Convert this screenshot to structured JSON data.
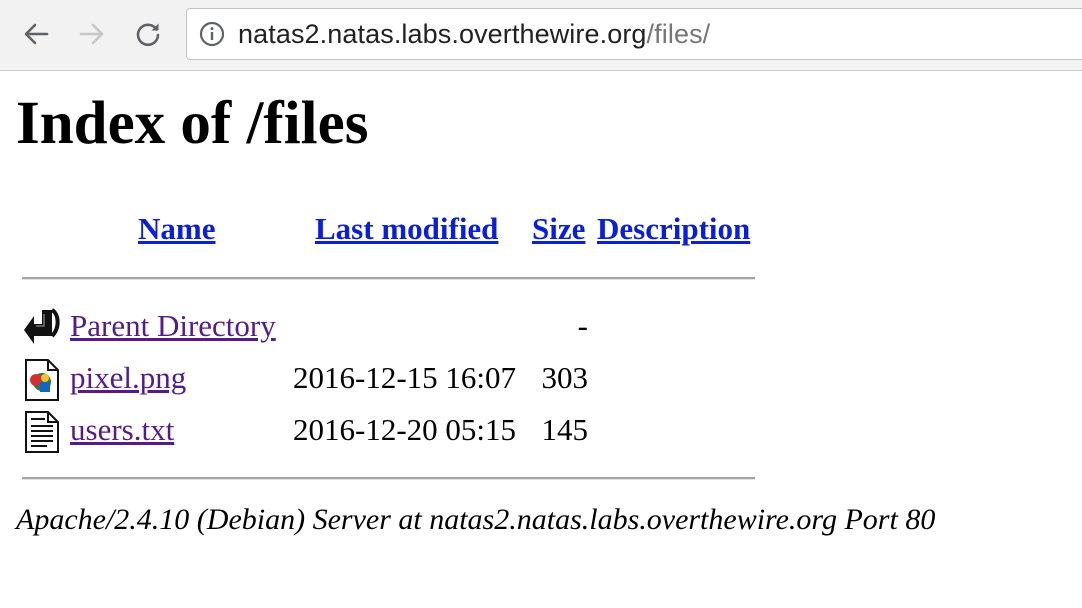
{
  "browser": {
    "url_host": "natas2.natas.labs.overthewire.org",
    "url_path": "/files/",
    "icons": {
      "back": "arrow-left-icon",
      "forward": "arrow-right-icon",
      "reload": "reload-icon",
      "site_info": "info-circle-icon"
    }
  },
  "page": {
    "title": "Index of /files",
    "columns": {
      "name": "Name",
      "modified": "Last modified",
      "size": "Size",
      "description": "Description"
    },
    "rows": [
      {
        "icon": "back-arrow-icon",
        "name": "Parent Directory",
        "modified": "",
        "size": "-",
        "description": ""
      },
      {
        "icon": "image-file-icon",
        "name": "pixel.png",
        "modified": "2016-12-15 16:07",
        "size": "303",
        "description": ""
      },
      {
        "icon": "text-file-icon",
        "name": "users.txt",
        "modified": "2016-12-20 05:15",
        "size": "145",
        "description": ""
      }
    ],
    "footer": "Apache/2.4.10 (Debian) Server at natas2.natas.labs.overthewire.org Port 80"
  },
  "colors": {
    "link": "#0b1ed8",
    "visited_link": "#551a8b",
    "toolbar_bg": "#f2f2f2"
  }
}
